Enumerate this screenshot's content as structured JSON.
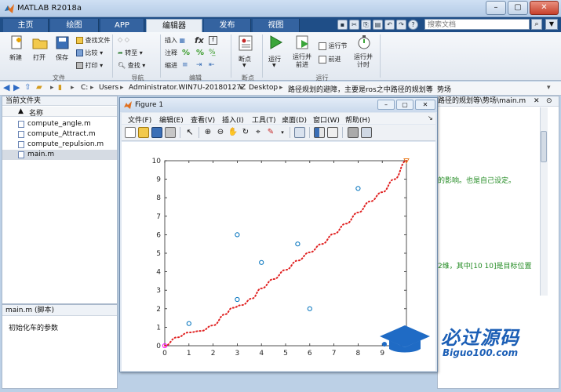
{
  "app": {
    "title": "MATLAB R2018a",
    "search_placeholder": "搜索文档"
  },
  "tabs": [
    {
      "label": "主页",
      "active": false
    },
    {
      "label": "绘图",
      "active": false
    },
    {
      "label": "APP",
      "active": false
    },
    {
      "label": "编辑器",
      "active": true
    },
    {
      "label": "发布",
      "active": false
    },
    {
      "label": "视图",
      "active": false
    }
  ],
  "ribbon": {
    "file": {
      "new": "新建",
      "open": "打开",
      "save": "保存",
      "find_files": "查找文件",
      "compare": "比较",
      "print": "打印",
      "group": "文件"
    },
    "navigate": {
      "goto": "转至",
      "find": "查找",
      "group": "导航"
    },
    "edit": {
      "insert": "插入",
      "comment": "注释",
      "indent": "缩进",
      "group": "编辑"
    },
    "breakpoints": {
      "label": "断点",
      "group": "断点"
    },
    "run": {
      "run": "运行",
      "run_advance": "运行并\n前进",
      "run_section": "运行节",
      "advance": "前进",
      "run_time": "运行并\n计时",
      "group": "运行"
    }
  },
  "path": {
    "segments": [
      "C:",
      "Users",
      "Administrator.WIN7U-20180127Z",
      "Desktop",
      "路径规划的避障，主要是ros之中路径的规划等",
      "势场"
    ]
  },
  "current_folder": {
    "title": "当前文件夹",
    "column": "名称",
    "sort": "▲",
    "files": [
      {
        "name": "compute_angle.m",
        "selected": false
      },
      {
        "name": "compute_Attract.m",
        "selected": false
      },
      {
        "name": "compute_repulsion.m",
        "selected": false
      },
      {
        "name": "main.m",
        "selected": true
      }
    ]
  },
  "details": {
    "title": "main.m  (脚本)",
    "text": "初始化车的参数"
  },
  "editor": {
    "path_fragment": "路径的规划等\\势场\\main.m",
    "lines": [
      {
        "text": "的影响。也是自己设定。",
        "color": "#228b22"
      },
      {
        "text": "2维，其中[10 10]是目标位置",
        "color": "#228b22"
      }
    ]
  },
  "figure": {
    "title": "Figure 1",
    "menu": [
      "文件(F)",
      "编辑(E)",
      "查看(V)",
      "插入(I)",
      "工具(T)",
      "桌面(D)",
      "窗口(W)",
      "帮助(H)"
    ]
  },
  "chart_data": {
    "type": "scatter",
    "title": "",
    "xlabel": "",
    "ylabel": "",
    "xlim": [
      0,
      10
    ],
    "ylim": [
      0,
      10
    ],
    "xticks": [
      "0",
      "1",
      "2",
      "3",
      "4",
      "5",
      "6",
      "7",
      "8",
      "9"
    ],
    "yticks": [
      "0",
      "1",
      "2",
      "3",
      "4",
      "5",
      "6",
      "7",
      "8",
      "9",
      "10"
    ],
    "grid": false,
    "series": [
      {
        "marker": "o",
        "color": "#0072bd",
        "x": [
          1,
          3,
          3,
          4,
          5.5,
          6,
          8
        ],
        "y": [
          1.2,
          6,
          2.5,
          4.5,
          5.5,
          2,
          8.5
        ]
      },
      {
        "line": "dotted",
        "color": "#e02020",
        "x": [
          0,
          0.5,
          1.0,
          1.5,
          2.0,
          2.5,
          2.8,
          3.2,
          3.6,
          4.0,
          4.5,
          5.0,
          5.5,
          6.0,
          6.5,
          7.0,
          7.5,
          8.0,
          8.5,
          9.0,
          9.5,
          10.0
        ],
        "y": [
          0,
          0.45,
          0.72,
          0.8,
          1.1,
          1.7,
          2.05,
          2.2,
          2.55,
          3.1,
          3.6,
          4.1,
          4.6,
          5.05,
          5.5,
          6.05,
          6.6,
          7.2,
          7.8,
          8.3,
          9.0,
          10.0
        ]
      }
    ],
    "start": {
      "x": 0,
      "y": 0,
      "marker": "o",
      "color": "#ff00ff"
    },
    "goal": {
      "x": 10,
      "y": 10,
      "marker": "v",
      "color": "#e87a1d"
    }
  },
  "watermark": {
    "text": "必过源码",
    "url": "Biguo100.com"
  }
}
